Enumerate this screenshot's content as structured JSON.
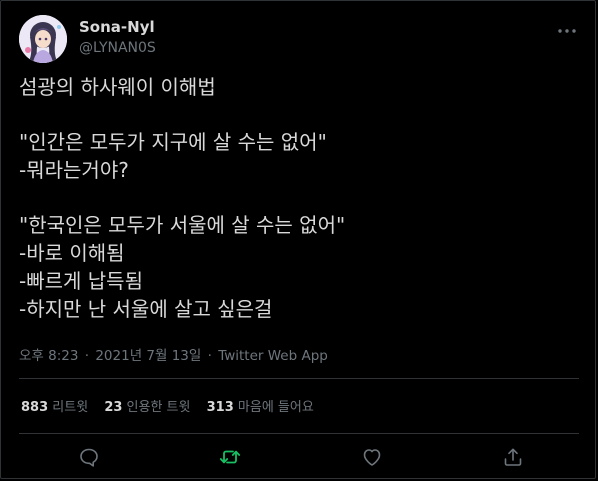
{
  "author": {
    "display_name": "Sona-Nyl",
    "handle": "@LYNAN0S"
  },
  "tweet": {
    "lines": [
      "섬광의 하사웨이 이해법",
      "",
      "\"인간은 모두가 지구에 살 수는 없어\"",
      "-뭐라는거야?",
      "",
      "\"한국인은 모두가 서울에 살 수는 없어\"",
      "-바로 이해됨",
      "-빠르게 납득됨",
      "-하지만 난 서울에 살고 싶은걸"
    ]
  },
  "meta": {
    "time": "오후 8:23",
    "separator": "·",
    "date": "2021년 7월 13일",
    "source": "Twitter Web App"
  },
  "stats": {
    "retweets_count": "883",
    "retweets_label": "리트윗",
    "quotes_count": "23",
    "quotes_label": "인용한 트윗",
    "likes_count": "313",
    "likes_label": "마음에 들어요"
  },
  "colors": {
    "background": "#000000",
    "text": "#d9d9d9",
    "muted": "#6e767d",
    "divider": "#2f3336",
    "retweet_accent": "#17bf63"
  },
  "icons": {
    "more": "more-horizontal-icon",
    "reply": "reply-icon",
    "retweet": "retweet-icon",
    "like": "heart-icon",
    "share": "share-icon"
  }
}
